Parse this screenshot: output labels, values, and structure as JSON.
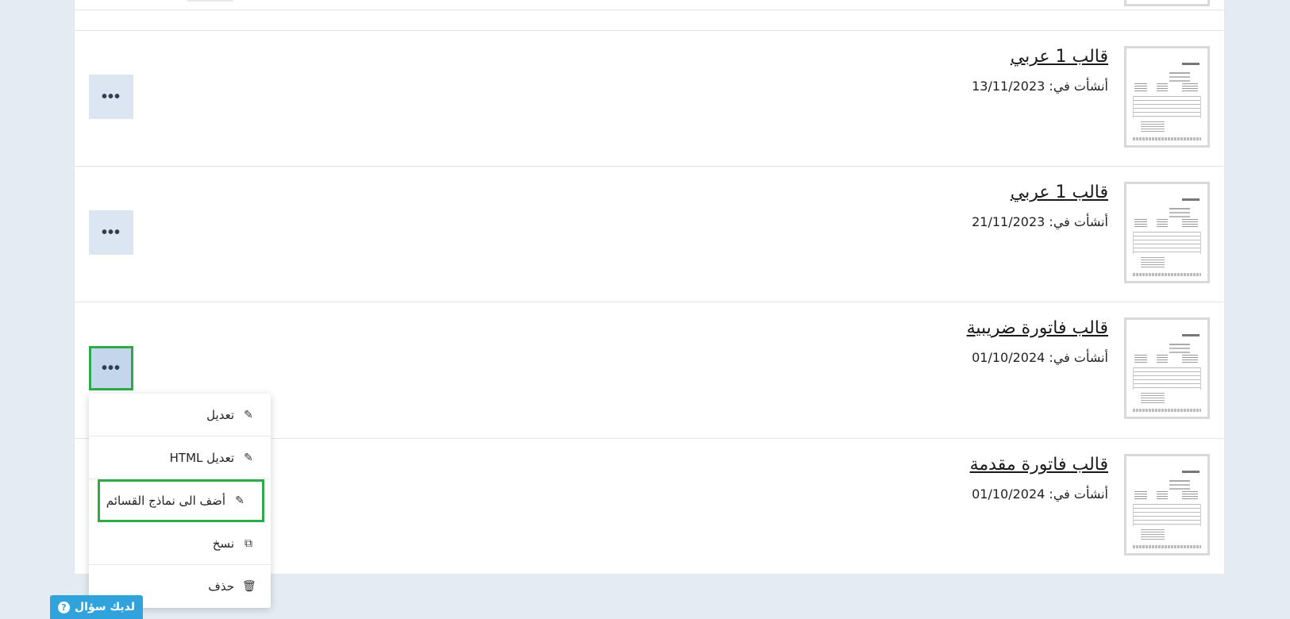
{
  "templates": [
    {
      "title": "قالب 1 عربي",
      "created_label": "أنشأت في:",
      "created_date": "13/11/2023"
    },
    {
      "title": "قالب 1 عربي",
      "created_label": "أنشأت في:",
      "created_date": "21/11/2023"
    },
    {
      "title": "قالب فاتورة ضريبية",
      "created_label": "أنشأت في:",
      "created_date": "01/10/2024"
    },
    {
      "title": "قالب فاتورة مقدمة",
      "created_label": "أنشأت في:",
      "created_date": "01/10/2024"
    }
  ],
  "more_button": {
    "icon": "ellipsis-icon",
    "label": "•••"
  },
  "menu": {
    "items": [
      {
        "label": "تعديل",
        "icon": "pencil-icon",
        "glyph": "✎"
      },
      {
        "label": "تعديل HTML",
        "icon": "pencil-icon",
        "glyph": "✎"
      },
      {
        "label": "أضف الى نماذج القسائم",
        "icon": "pencil-icon",
        "glyph": "✎"
      },
      {
        "label": "نسخ",
        "icon": "copy-icon",
        "glyph": "⧉"
      },
      {
        "label": "حذف",
        "icon": "trash-icon",
        "glyph": "🗑"
      }
    ]
  },
  "help": {
    "label": "لديك سؤال",
    "icon": "question-icon",
    "glyph": "?"
  },
  "colors": {
    "accent_highlight": "#2eab48",
    "button_bg": "#dbe6f2",
    "help_bg": "#30a3dd",
    "page_bg": "#e4ebf3"
  }
}
